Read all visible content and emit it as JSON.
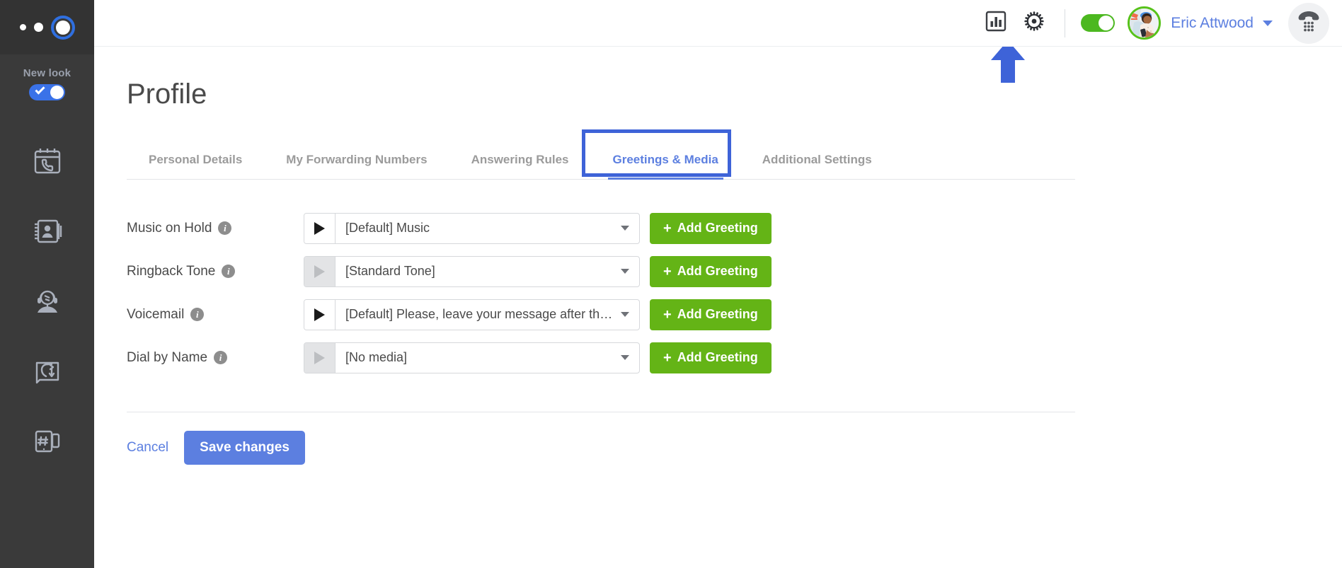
{
  "sidebar": {
    "logo_dots": [
      "dot-small",
      "dot-medium",
      "dot-ring-selected"
    ],
    "new_look": {
      "label": "New look",
      "toggle_state": "on",
      "toggle_color": "#3a72e8"
    },
    "items": [
      {
        "name": "calls-calendar",
        "icon": "phone-calendar-icon"
      },
      {
        "name": "contacts",
        "icon": "address-book-icon"
      },
      {
        "name": "agent",
        "icon": "headset-agent-icon"
      },
      {
        "name": "call-routing",
        "icon": "call-flow-icon"
      },
      {
        "name": "messaging",
        "icon": "hash-device-icon"
      }
    ]
  },
  "header": {
    "analytics_icon": "bar-chart-icon",
    "settings_icon": "gear-icon",
    "status_toggle": {
      "state": "on",
      "color": "#4cb820"
    },
    "avatar": "user-avatar",
    "username": "Eric Attwood",
    "chevron_icon": "chevron-down-icon",
    "dialpad_icon": "dialpad-handset-icon"
  },
  "main": {
    "title": "Profile",
    "tabs": [
      {
        "label": "Personal Details",
        "active": false
      },
      {
        "label": "My Forwarding Numbers",
        "active": false
      },
      {
        "label": "Answering Rules",
        "active": false
      },
      {
        "label": "Greetings & Media",
        "active": true
      },
      {
        "label": "Additional Settings",
        "active": false
      }
    ],
    "rows": [
      {
        "label": "Music on Hold",
        "info_icon": "info-icon",
        "play_enabled": true,
        "value": "[Default] Music",
        "add_label": "Add Greeting"
      },
      {
        "label": "Ringback Tone",
        "info_icon": "info-icon",
        "play_enabled": false,
        "value": "[Standard Tone]",
        "add_label": "Add Greeting"
      },
      {
        "label": "Voicemail",
        "info_icon": "info-icon",
        "play_enabled": true,
        "value": "[Default] Please, leave your message after the…",
        "add_label": "Add Greeting"
      },
      {
        "label": "Dial by Name",
        "info_icon": "info-icon",
        "play_enabled": false,
        "value": "[No media]",
        "add_label": "Add Greeting"
      }
    ],
    "cancel_label": "Cancel",
    "save_label": "Save changes"
  },
  "annotations": {
    "tab_highlight_color": "#3e63d8",
    "arrow_color": "#3e63d8",
    "arrow_target": "Eric Attwood"
  },
  "colors": {
    "accent_blue": "#5c7fe0",
    "green": "#64b416",
    "toggle_green": "#4cb820",
    "sidebar_bg": "#3a3a3a"
  }
}
